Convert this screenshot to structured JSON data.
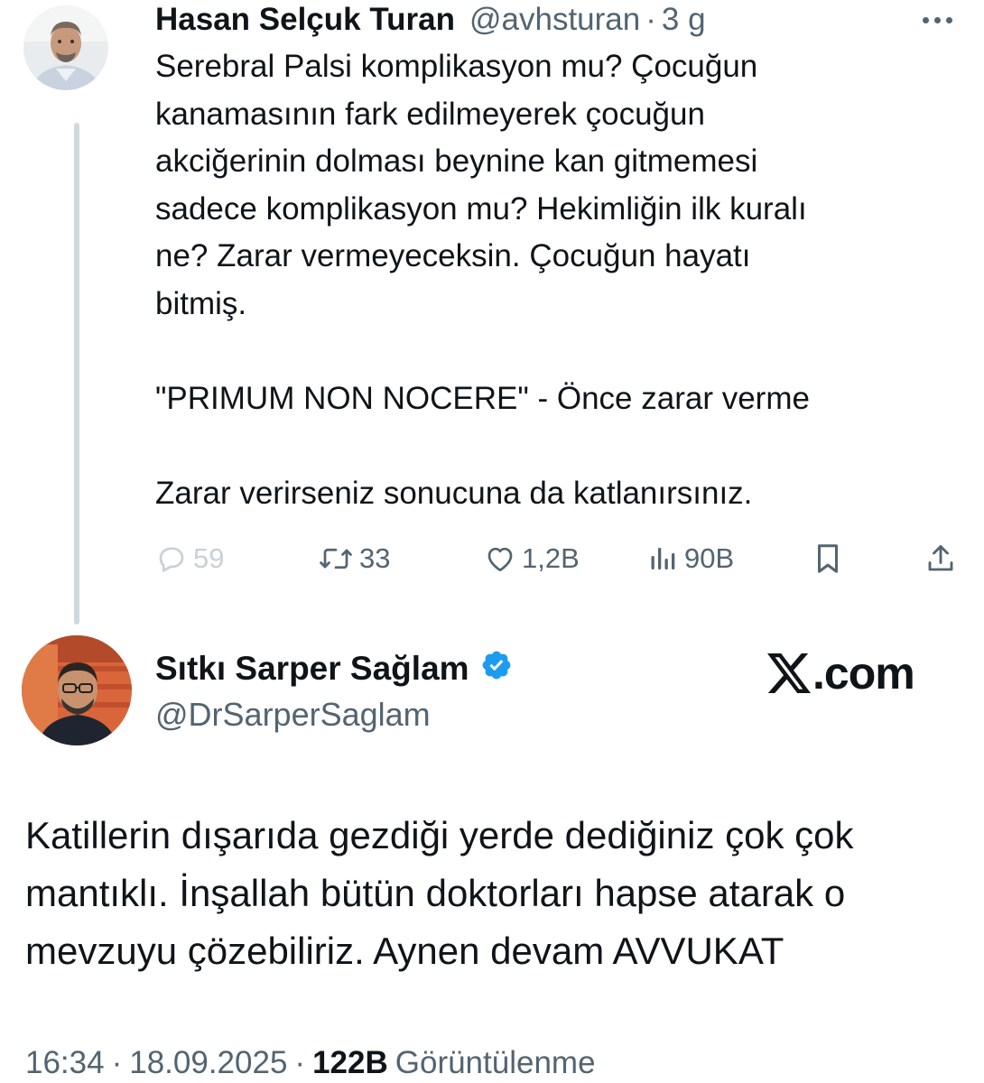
{
  "original_tweet": {
    "author_name": "Hasan Selçuk Turan",
    "author_handle": "@avhsturan",
    "separator": "·",
    "time_ago": "3 g",
    "body": "Serebral Palsi komplikasyon mu? Çocuğun\nkanamasının fark edilmeyerek çocuğun\nakciğerinin dolması beynine kan gitmemesi\nsadece komplikasyon mu? Hekimliğin ilk kuralı\nne? Zarar vermeyeceksin. Çocuğun hayatı\nbitmiş.\n\n\"PRIMUM NON NOCERE\" - Önce zarar verme\n\nZarar verirseniz sonucuna da katlanırsınız.",
    "stats": {
      "replies": "59",
      "reposts": "33",
      "likes": "1,2B",
      "views": "90B"
    },
    "icons": {
      "more": "more-horizontal-icon",
      "reply": "reply-icon",
      "repost": "repost-icon",
      "like": "heart-icon",
      "views": "views-bar-chart-icon",
      "bookmark": "bookmark-icon",
      "share": "share-icon"
    }
  },
  "reply_tweet": {
    "author_name": "Sıtkı Sarper Sağlam",
    "author_handle": "@DrSarperSaglam",
    "verified": true,
    "body": "Katillerin dışarıda gezdiği yerde dediğiniz çok çok\nmantıklı. İnşallah bütün doktorları hapse atarak o\nmevzuyu çözebiliriz. Aynen devam AVVUKAT",
    "timestamp": "16:34",
    "date": "18.09.2025",
    "separator": "·",
    "views_count": "122B",
    "views_label": "Görüntülenme"
  },
  "branding": {
    "logo_domain": ".com",
    "logo_icon": "x-logo-icon"
  },
  "colors": {
    "text_primary": "#0f1419",
    "text_secondary": "#536471",
    "verified_blue": "#1d9bf0",
    "thread_line": "#cfd9de"
  }
}
